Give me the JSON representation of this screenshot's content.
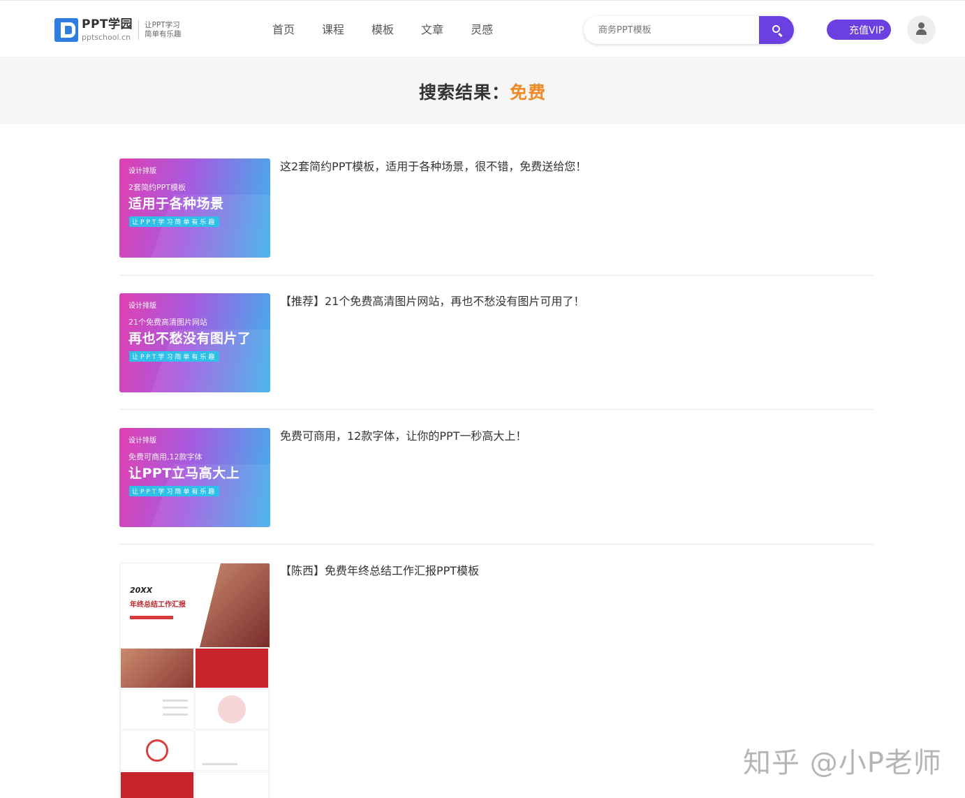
{
  "header": {
    "logo_title": "PPT学园",
    "logo_domain": "pptschool.cn",
    "logo_slogan_1": "让PPT学习",
    "logo_slogan_2": "简单有乐趣",
    "nav": [
      "首页",
      "课程",
      "模板",
      "文章",
      "灵感"
    ],
    "search_placeholder": "商务PPT模板",
    "vip_label": "充值VIP"
  },
  "banner": {
    "prefix": "搜索结果：",
    "keyword": "免费"
  },
  "results": [
    {
      "title": "这2套简约PPT模板，适用于各种场景，很不错，免费送给您！",
      "thumb_tag": "设计排版",
      "thumb_sub": "2套简约PPT模板",
      "thumb_main": "适用于各种场景",
      "thumb_slogan": "让PPT学习简单有乐趣"
    },
    {
      "title": "【推荐】21个免费高清图片网站，再也不愁没有图片可用了！",
      "thumb_tag": "设计排版",
      "thumb_sub": "21个免费高清图片网站",
      "thumb_main": "再也不愁没有图片了",
      "thumb_slogan": "让PPT学习简单有乐趣"
    },
    {
      "title": "免费可商用，12款字体，让你的PPT一秒高大上！",
      "thumb_tag": "设计排版",
      "thumb_sub": "免费可商用,12款字体",
      "thumb_main": "让PPT立马高大上",
      "thumb_slogan": "让PPT学习简单有乐趣"
    },
    {
      "title": "【陈西】免费年终总结工作汇报PPT模板",
      "thumb_year": "20XX",
      "thumb_name": "年终总结工作汇报"
    }
  ],
  "watermark": "知乎 @小P老师",
  "colors": {
    "accent": "#6c3fe0",
    "keyword": "#f08a24",
    "logo_blue": "#2f7de1"
  }
}
